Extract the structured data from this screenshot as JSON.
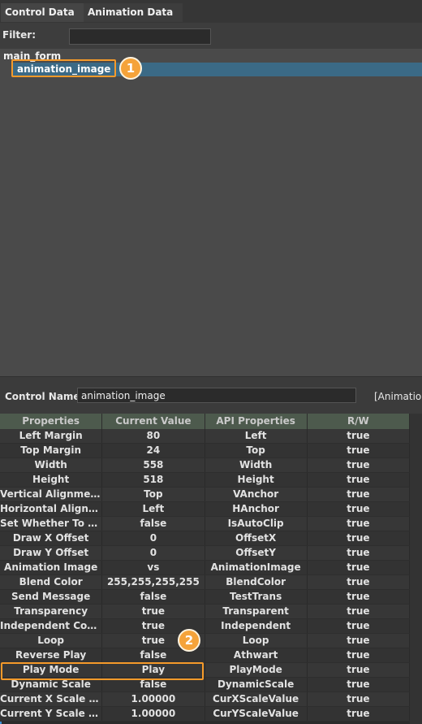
{
  "tabs": [
    "Control Data",
    "Animation Data"
  ],
  "filter": {
    "label": "Filter:",
    "value": ""
  },
  "tree": {
    "root": "main_form",
    "selected_child": "animation_image"
  },
  "badges": [
    "1",
    "2"
  ],
  "control": {
    "label": "Control Name:",
    "value": "animation_image",
    "right_text": "[Animation"
  },
  "grid": {
    "headers": [
      "Properties",
      "Current Value",
      "API Properties",
      "R/W"
    ],
    "rows": [
      [
        "Left Margin",
        "80",
        "Left",
        "true"
      ],
      [
        "Top Margin",
        "24",
        "Top",
        "true"
      ],
      [
        "Width",
        "558",
        "Width",
        "true"
      ],
      [
        "Height",
        "518",
        "Height",
        "true"
      ],
      [
        "Vertical Alignment",
        "Top",
        "VAnchor",
        "true"
      ],
      [
        "Horizontal Alignment",
        "Left",
        "HAnchor",
        "true"
      ],
      [
        "Set Whether To Cli...",
        "false",
        "IsAutoClip",
        "true"
      ],
      [
        "Draw X Offset",
        "0",
        "OffsetX",
        "true"
      ],
      [
        "Draw Y Offset",
        "0",
        "OffsetY",
        "true"
      ],
      [
        "Animation Image",
        "vs",
        "AnimationImage",
        "true"
      ],
      [
        "Blend Color",
        "255,255,255,255",
        "BlendColor",
        "true"
      ],
      [
        "Send Message",
        "false",
        "TestTrans",
        "true"
      ],
      [
        "Transparency",
        "true",
        "Transparent",
        "true"
      ],
      [
        "Independent Contr...",
        "true",
        "Independent",
        "true"
      ],
      [
        "Loop",
        "true",
        "Loop",
        "true"
      ],
      [
        "Reverse Play",
        "false",
        "Athwart",
        "true"
      ],
      [
        "Play Mode",
        "Play",
        "PlayMode",
        "true"
      ],
      [
        "Dynamic Scale",
        "false",
        "DynamicScale",
        "true"
      ],
      [
        "Current X Scale Value",
        "1.00000",
        "CurXScaleValue",
        "true"
      ],
      [
        "Current Y Scale Value",
        "1.00000",
        "CurYScaleValue",
        "true"
      ]
    ]
  }
}
